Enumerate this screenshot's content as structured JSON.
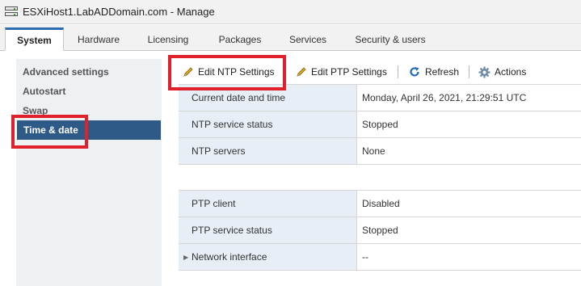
{
  "window": {
    "title": "ESXiHost1.LabADDomain.com - Manage",
    "icon": "server-host-icon"
  },
  "tabs": [
    {
      "label": "System",
      "active": true
    },
    {
      "label": "Hardware",
      "active": false
    },
    {
      "label": "Licensing",
      "active": false
    },
    {
      "label": "Packages",
      "active": false
    },
    {
      "label": "Services",
      "active": false
    },
    {
      "label": "Security & users",
      "active": false
    }
  ],
  "sidebar": {
    "items": [
      {
        "label": "Advanced settings",
        "selected": false
      },
      {
        "label": "Autostart",
        "selected": false
      },
      {
        "label": "Swap",
        "selected": false
      },
      {
        "label": "Time & date",
        "selected": true
      }
    ]
  },
  "toolbar": {
    "edit_ntp": {
      "label": "Edit NTP Settings",
      "icon": "pencil-icon"
    },
    "edit_ptp": {
      "label": "Edit PTP Settings",
      "icon": "pencil-icon"
    },
    "refresh": {
      "label": "Refresh",
      "icon": "refresh-icon"
    },
    "actions": {
      "label": "Actions",
      "icon": "gear-icon"
    }
  },
  "ntp_table": [
    {
      "key": "Current date and time",
      "value": "Monday, April 26, 2021, 21:29:51 UTC"
    },
    {
      "key": "NTP service status",
      "value": "Stopped"
    },
    {
      "key": "NTP servers",
      "value": "None"
    }
  ],
  "ptp_table": [
    {
      "key": "PTP client",
      "value": "Disabled"
    },
    {
      "key": "PTP service status",
      "value": "Stopped"
    },
    {
      "key": "Network interface",
      "value": "--",
      "expandable": true
    }
  ],
  "colors": {
    "accent": "#2b6cb0",
    "selected_sidebar": "#2e5a87",
    "key_cell_bg": "#e7eef5",
    "highlight": "#e0202a",
    "refresh_icon": "#1e6bb8",
    "gear_icon": "#6f8da8",
    "pencil_icon": "#d9a521"
  }
}
